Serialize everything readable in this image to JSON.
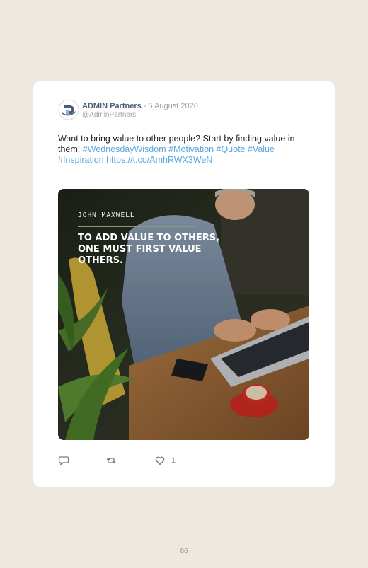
{
  "tweet": {
    "author_name": "ADMIN Partners",
    "date": "- 5 August 2020",
    "handle": "@AdminPartners",
    "text_plain": "Want to bring value to other people? Start by finding value in them!",
    "text_links": "#WednesdayWisdom #Motivation #Quote #Value #Inspiration https://t.co/AmhRWX3WeN",
    "image": {
      "author": "JOHN MAXWELL",
      "quote": "TO ADD VALUE TO OTHERS, ONE MUST FIRST VALUE OTHERS."
    },
    "actions": {
      "reply_icon": "reply-icon",
      "retweet_icon": "retweet-icon",
      "like_icon": "heart-icon",
      "like_count": "1"
    }
  },
  "page_number": "86",
  "colors": {
    "background": "#ede9e1",
    "card": "#ffffff",
    "link": "#5aa8e0",
    "name": "#4a5f7a"
  }
}
